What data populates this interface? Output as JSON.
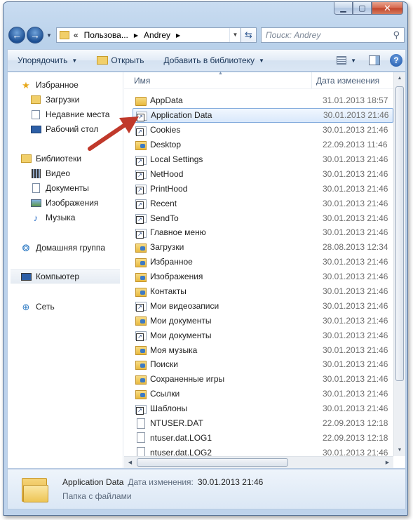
{
  "address": {
    "overflow": "«",
    "crumbs": [
      "Пользова...",
      "Andrey"
    ]
  },
  "search": {
    "placeholder": "Поиск: Andrey"
  },
  "toolbar": {
    "organize": "Упорядочить",
    "open": "Открыть",
    "add_to_library": "Добавить в библиотеку"
  },
  "nav": {
    "favorites": "Избранное",
    "downloads": "Загрузки",
    "recent": "Недавние места",
    "desktop": "Рабочий стол",
    "libraries": "Библиотеки",
    "video": "Видео",
    "documents": "Документы",
    "images": "Изображения",
    "music": "Музыка",
    "homegroup": "Домашняя группа",
    "computer": "Компьютер",
    "network": "Сеть"
  },
  "columns": {
    "name": "Имя",
    "date": "Дата изменения"
  },
  "files": [
    {
      "name": "AppData",
      "date": "31.01.2013 18:57",
      "icon": "folder-icon"
    },
    {
      "name": "Application Data",
      "date": "30.01.2013 21:46",
      "icon": "shortcut-folder-icon",
      "selected": true
    },
    {
      "name": "Cookies",
      "date": "30.01.2013 21:46",
      "icon": "shortcut-folder-icon"
    },
    {
      "name": "Desktop",
      "date": "22.09.2013 11:46",
      "icon": "special-folder-icon"
    },
    {
      "name": "Local Settings",
      "date": "30.01.2013 21:46",
      "icon": "shortcut-folder-icon"
    },
    {
      "name": "NetHood",
      "date": "30.01.2013 21:46",
      "icon": "shortcut-folder-icon"
    },
    {
      "name": "PrintHood",
      "date": "30.01.2013 21:46",
      "icon": "shortcut-folder-icon"
    },
    {
      "name": "Recent",
      "date": "30.01.2013 21:46",
      "icon": "shortcut-folder-icon"
    },
    {
      "name": "SendTo",
      "date": "30.01.2013 21:46",
      "icon": "shortcut-folder-icon"
    },
    {
      "name": "Главное меню",
      "date": "30.01.2013 21:46",
      "icon": "shortcut-folder-icon"
    },
    {
      "name": "Загрузки",
      "date": "28.08.2013 12:34",
      "icon": "special-folder-icon"
    },
    {
      "name": "Избранное",
      "date": "30.01.2013 21:46",
      "icon": "special-folder-icon"
    },
    {
      "name": "Изображения",
      "date": "30.01.2013 21:46",
      "icon": "special-folder-icon"
    },
    {
      "name": "Контакты",
      "date": "30.01.2013 21:46",
      "icon": "special-folder-icon"
    },
    {
      "name": "Мои видеозаписи",
      "date": "30.01.2013 21:46",
      "icon": "shortcut-folder-icon"
    },
    {
      "name": "Мои документы",
      "date": "30.01.2013 21:46",
      "icon": "special-folder-icon"
    },
    {
      "name": "Мои документы",
      "date": "30.01.2013 21:46",
      "icon": "shortcut-folder-icon"
    },
    {
      "name": "Моя музыка",
      "date": "30.01.2013 21:46",
      "icon": "special-folder-icon"
    },
    {
      "name": "Поиски",
      "date": "30.01.2013 21:46",
      "icon": "special-folder-icon"
    },
    {
      "name": "Сохраненные игры",
      "date": "30.01.2013 21:46",
      "icon": "special-folder-icon"
    },
    {
      "name": "Ссылки",
      "date": "30.01.2013 21:46",
      "icon": "special-folder-icon"
    },
    {
      "name": "Шаблоны",
      "date": "30.01.2013 21:46",
      "icon": "shortcut-folder-icon"
    },
    {
      "name": "NTUSER.DAT",
      "date": "22.09.2013 12:18",
      "icon": "file-icon"
    },
    {
      "name": "ntuser.dat.LOG1",
      "date": "22.09.2013 12:18",
      "icon": "file-icon"
    },
    {
      "name": "ntuser.dat.LOG2",
      "date": "30.01.2013 21:46",
      "icon": "file-icon"
    }
  ],
  "details": {
    "name": "Application Data",
    "modified_label": "Дата изменения:",
    "modified_value": "30.01.2013 21:46",
    "type": "Папка с файлами"
  },
  "colors": {
    "annotation_arrow": "#c0392b",
    "selection": "#d9e8fb"
  }
}
